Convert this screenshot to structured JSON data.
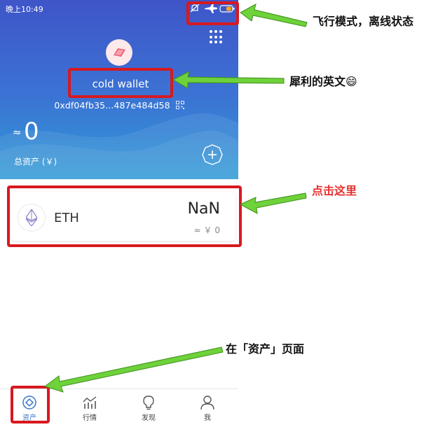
{
  "status_bar": {
    "time": "晚上10:49"
  },
  "wallet": {
    "name": "cold wallet",
    "address": "0xdf04fb35...487e484d58",
    "balance_approx": "≈",
    "balance": "0",
    "total_assets_label": "总资产 (￥)"
  },
  "assets": [
    {
      "symbol": "ETH",
      "amount": "NaN",
      "fiat": "≈ ￥ 0",
      "icon": "ethereum-icon"
    }
  ],
  "tabs": [
    {
      "label": "资产",
      "icon": "assets-icon",
      "active": true
    },
    {
      "label": "行情",
      "icon": "market-chart-icon",
      "active": false
    },
    {
      "label": "发现",
      "icon": "lightbulb-icon",
      "active": false
    },
    {
      "label": "我",
      "icon": "person-icon",
      "active": false
    }
  ],
  "annotations": {
    "offline": "飞行模式，离线状态",
    "english": "犀利的英文😄",
    "click_here": "点击这里",
    "assets_page": "在「资产」页面"
  },
  "colors": {
    "header_top": "#3f55c8",
    "header_bottom": "#2f9ad6",
    "annotation_box": "#d7191f",
    "arrow": "#6ed23a",
    "click_text": "#e63232",
    "active_tab": "#3a78c8"
  }
}
